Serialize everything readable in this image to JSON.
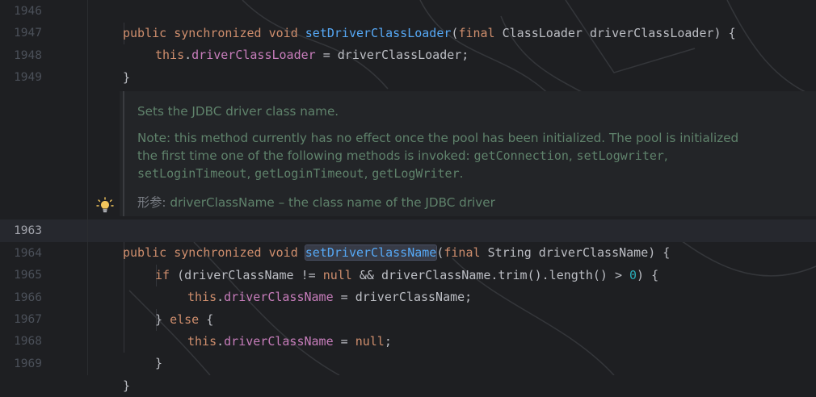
{
  "editor": {
    "lines": [
      {
        "no": "1946",
        "code": "public synchronized void setDriverClassLoader(final ClassLoader driverClassLoader) {"
      },
      {
        "no": "1947",
        "code": "this.driverClassLoader = driverClassLoader;"
      },
      {
        "no": "1948",
        "code": "}"
      },
      {
        "no": "1949",
        "code": ""
      },
      {
        "no": "1963",
        "code": "public synchronized void setDriverClassName(final String driverClassName) {"
      },
      {
        "no": "1964",
        "code": "if (driverClassName != null && driverClassName.trim().length() > 0) {"
      },
      {
        "no": "1965",
        "code": "this.driverClassName = driverClassName;"
      },
      {
        "no": "1966",
        "code": "} else {"
      },
      {
        "no": "1967",
        "code": "this.driverClassName = null;"
      },
      {
        "no": "1968",
        "code": "}"
      },
      {
        "no": "1969",
        "code": "}"
      }
    ],
    "current_line": "1963"
  },
  "doc": {
    "summary": "Sets the JDBC driver class name.",
    "note_line1": "Note: this method currently has no effect once the pool has been initialized. The pool is initialized",
    "note_line2_prefix": "the first time one of the following methods is invoked: ",
    "note_line2_code1": "getConnection",
    "note_line2_sep1": ", ",
    "note_line2_code2": "setLogwriter",
    "note_line2_sep2": ",",
    "note_line3_code1": "setLoginTimeout",
    "note_line3_sep1": ", ",
    "note_line3_code2": "getLoginTimeout",
    "note_line3_sep2": ", ",
    "note_line3_code3": "getLogWriter",
    "note_line3_end": ".",
    "param_tag": "形参:",
    "param_text": "driverClassName – the class name of the JDBC driver"
  },
  "icons": {
    "bulb": "lightbulb-icon"
  },
  "colors": {
    "background": "#1e1f22",
    "keyword": "#cf8e6d",
    "method": "#56a8f5",
    "field": "#c77dbb",
    "number": "#2aacb8",
    "doc": "#5f826b"
  }
}
